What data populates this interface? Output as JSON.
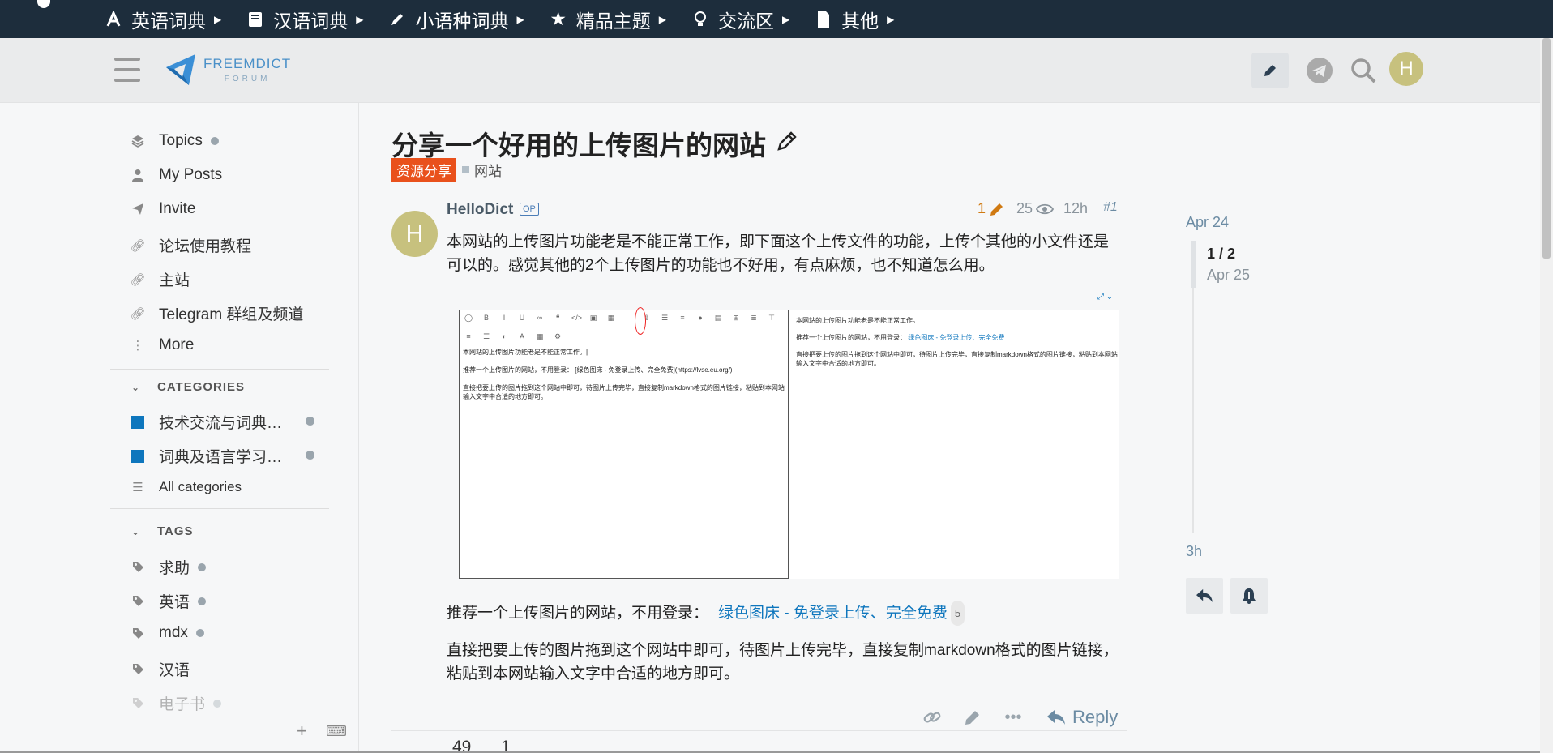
{
  "topnav": {
    "items": [
      {
        "label": "英语词典",
        "icon": "letter-a-icon"
      },
      {
        "label": "汉语词典",
        "icon": "book-icon"
      },
      {
        "label": "小语种词典",
        "icon": "pencil-icon"
      },
      {
        "label": "精品主题",
        "icon": "star-icon"
      },
      {
        "label": "交流区",
        "icon": "lightbulb-icon"
      },
      {
        "label": "其他",
        "icon": "file-icon"
      }
    ]
  },
  "header": {
    "logo_line1": "FREEMDICT",
    "logo_line2": "FORUM",
    "avatar_letter": "H"
  },
  "sidebar": {
    "nav": [
      {
        "label": "Topics",
        "icon": "layers-icon",
        "dot": true
      },
      {
        "label": "My Posts",
        "icon": "user-icon",
        "dot": false
      },
      {
        "label": "Invite",
        "icon": "paper-plane-icon",
        "dot": false
      },
      {
        "label": "论坛使用教程",
        "icon": "link-icon",
        "dot": false
      },
      {
        "label": "主站",
        "icon": "link-icon",
        "dot": false
      },
      {
        "label": "Telegram 群组及频道",
        "icon": "link-icon",
        "dot": false
      },
      {
        "label": "More",
        "icon": "more-vertical-icon",
        "dot": false
      }
    ],
    "categories_title": "CATEGORIES",
    "categories": [
      {
        "label": "技术交流与词典…",
        "color": "#0e76bd"
      },
      {
        "label": "词典及语言学习…",
        "color": "#0e76bd"
      }
    ],
    "all_categories": "All categories",
    "tags_title": "TAGS",
    "tags": [
      {
        "label": "求助",
        "dot": true
      },
      {
        "label": "英语",
        "dot": true
      },
      {
        "label": "mdx",
        "dot": true
      },
      {
        "label": "汉语",
        "dot": false
      },
      {
        "label": "电子书",
        "dot": true
      }
    ],
    "footer_plus": "+",
    "footer_keyboard": "⌨"
  },
  "topic": {
    "title": "分享一个好用的上传图片的网站",
    "category": "资源分享",
    "tag": "网站"
  },
  "post": {
    "avatar_letter": "H",
    "author": "HelloDict",
    "op_badge": "OP",
    "edits": "1",
    "views": "25",
    "age": "12h",
    "post_number": "#1",
    "paragraph1": "本网站的上传图片功能老是不能正常工作，即下面这个上传文件的功能，上传个其他的小文件还是可以的。感觉其他的2个上传图片的功能也不好用，有点麻烦，也不知道怎么用。",
    "paragraph2_prefix": "推荐一个上传图片的网站，不用登录：",
    "paragraph2_link": "绿色图床 - 免登录上传、完全免费",
    "paragraph2_link_count": "5",
    "paragraph3": "直接把要上传的图片拖到这个网站中即可，待图片上传完毕，直接复制markdown格式的图片链接，粘贴到本网站输入文字中合适的地方即可。",
    "reply_label": "Reply",
    "stat_likes": "49",
    "stat_links": "1"
  },
  "screenshot": {
    "editor_line1": "本网站的上传图片功能老是不能正常工作。|",
    "editor_line2": "推荐一个上传图片的网站，不用登录：  [绿色图床 - 免登录上传、完全免费](https://lvse.eu.org/)",
    "editor_line3": "直接把要上传的图片拖到这个网站中即可，待图片上传完毕，直接复制markdown格式的图片链接，粘贴到本网站输入文字中合适的地方即可。",
    "preview_line1": "本网站的上传图片功能老是不能正常工作。",
    "preview_line2_prefix": "推荐一个上传图片的网站，不用登录：",
    "preview_line2_link": "绿色图床 - 免登录上传、完全免费",
    "preview_line3": "直接把要上传的图片拖到这个网站中即可，待图片上传完毕，直接复制markdown格式的图片链接，粘贴到本网站输入文字中合适的地方即可。"
  },
  "timeline": {
    "start_date": "Apr 24",
    "position": "1 / 2",
    "current_date": "Apr 25",
    "end_label": "3h"
  }
}
